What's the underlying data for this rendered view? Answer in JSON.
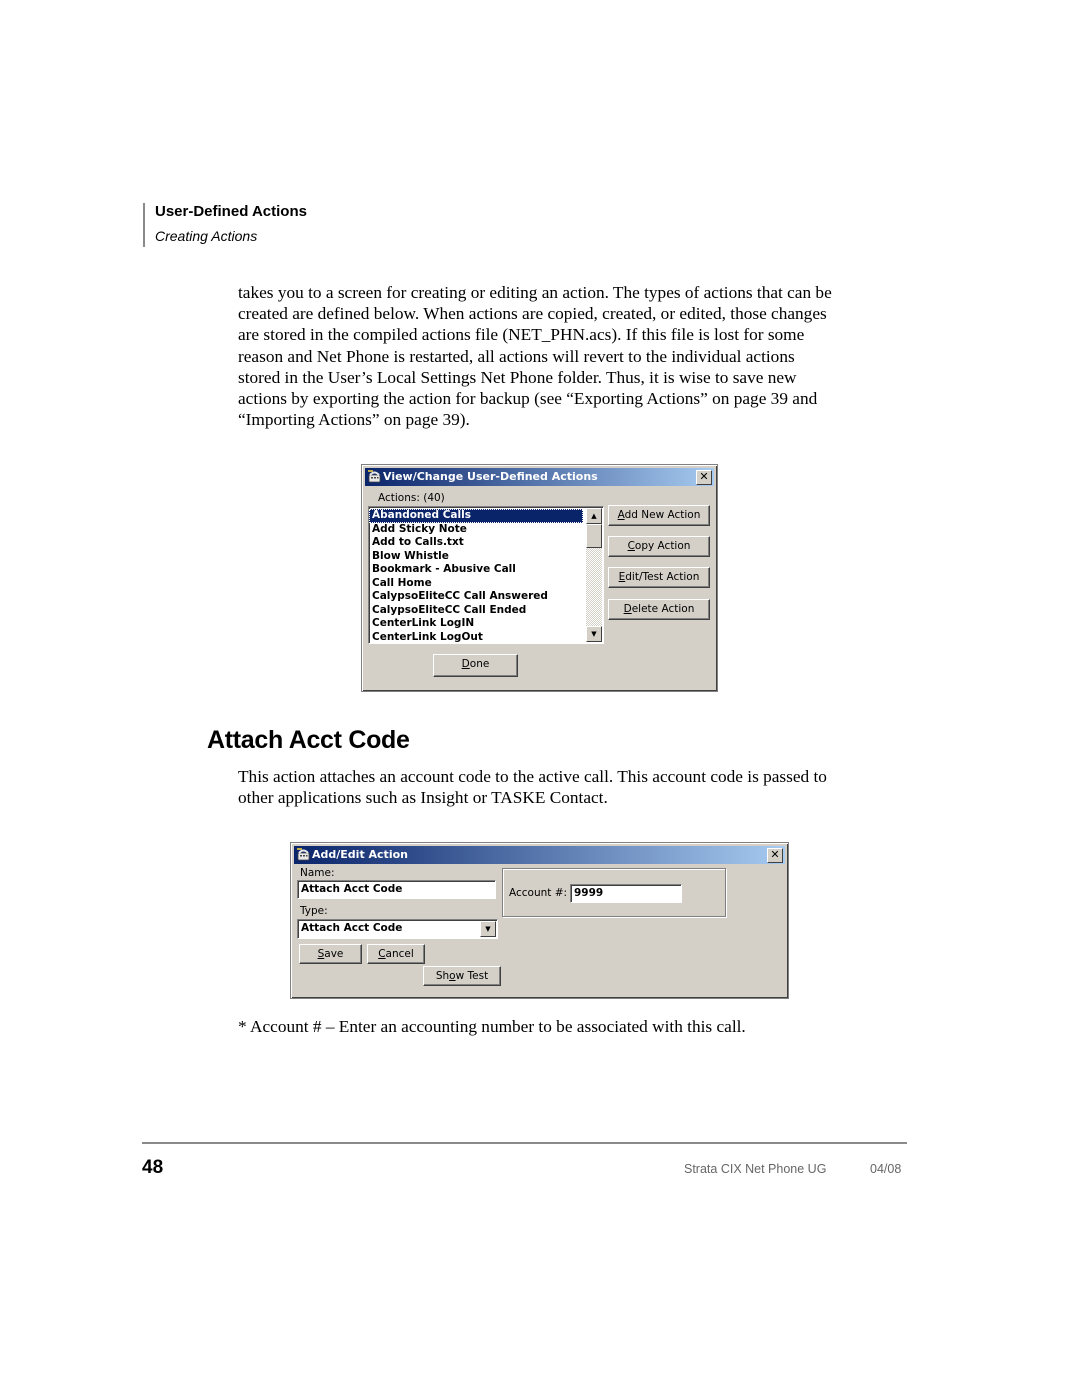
{
  "header": {
    "section_title": "User-Defined Actions",
    "section_subtitle": "Creating Actions"
  },
  "intro_paragraph": [
    "takes you to a screen for creating or editing an action.  The types of actions that can be",
    "created are defined below.  When actions are copied, created, or edited, those changes",
    "are stored in the compiled actions file (NET_PHN.acs).  If this file is lost for some",
    "reason and Net Phone is restarted, all actions will revert to the individual actions",
    "stored in the User’s Local Settings Net Phone folder.  Thus, it is wise to save new",
    "actions by exporting the action for backup (see “Exporting Actions” on page 39 and",
    "“Importing Actions” on page 39)."
  ],
  "dialog1": {
    "title": "View/Change User-Defined Actions",
    "close_glyph": "✕",
    "actions_label": "Actions: (40)",
    "list_items": [
      "Abandoned Calls",
      "Add Sticky Note",
      "Add to Calls.txt",
      "Blow Whistle",
      "Bookmark - Abusive Call",
      "Call Home",
      "CalypsoEliteCC Call Answered",
      "CalypsoEliteCC Call Ended",
      "CenterLink LogIN",
      "CenterLink LogOut"
    ],
    "selected_item": "Abandoned Calls",
    "buttons": {
      "add_new_action": {
        "accel": "A",
        "rest": "dd New Action"
      },
      "copy_action": {
        "accel": "C",
        "rest": "opy Action"
      },
      "edit_test_action": {
        "accel": "E",
        "rest": "dit/Test Action"
      },
      "delete_action": {
        "accel": "D",
        "rest": "elete Action"
      },
      "done": {
        "accel": "D",
        "rest": "one"
      }
    },
    "scroll_up_glyph": "▲",
    "scroll_down_glyph": "▼"
  },
  "section": {
    "heading": "Attach Acct Code",
    "paragraph": [
      "This action attaches an account code to the active call.  This account code is passed to",
      "other applications such as Insight or TASKE Contact."
    ]
  },
  "dialog2": {
    "title": "Add/Edit Action",
    "close_glyph": "✕",
    "name_label": "Name:",
    "name_value": "Attach Acct Code",
    "type_label": "Type:",
    "type_value": "Attach Acct Code",
    "dropdown_glyph": "▼",
    "account_label": "Account #:",
    "account_value": "9999",
    "buttons": {
      "save": {
        "accel": "S",
        "rest": "ave"
      },
      "cancel": {
        "accel": "C",
        "rest": "ancel"
      },
      "show_test_pre": "Sh",
      "show_test_accel": "o",
      "show_test_post": "w Test"
    }
  },
  "footnote": "* Account # – Enter an accounting number to be associated with this call.",
  "footer": {
    "page_number": "48",
    "doc_title": "Strata CIX Net Phone UG",
    "doc_date": "04/08"
  }
}
